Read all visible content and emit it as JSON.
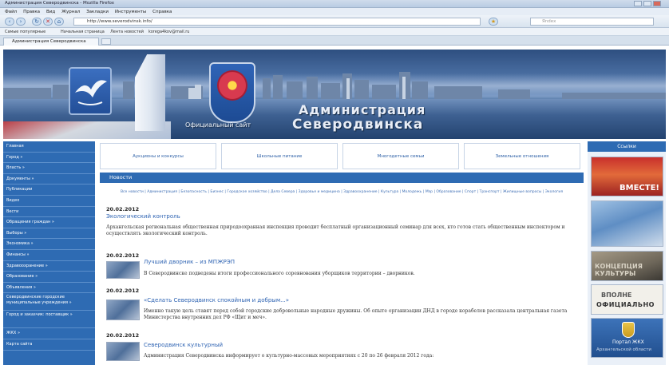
{
  "browser": {
    "window_title": "Администрация Северодвинска - Mozilla Firefox",
    "menu": [
      "Файл",
      "Правка",
      "Вид",
      "Журнал",
      "Закладки",
      "Инструменты",
      "Справка"
    ],
    "url": "http://www.severodvinsk.info/",
    "search_placeholder": "Яndex",
    "bookmarks": [
      "Самые популярные",
      "Начальная страница",
      "Лента новостей",
      "korega4kov@mail.ru"
    ],
    "tab_title": "Администрация Северодвинска"
  },
  "banner": {
    "title_line1": "Администрация",
    "title_line2": "Северодвинска",
    "subtitle": "Официальный сайт"
  },
  "sidebar": {
    "items": [
      "Главная",
      "Город »",
      "Власть »",
      "Документы »",
      "Публикации",
      "Видео",
      "Вести",
      "Обращения граждан »",
      "Выборы »",
      "Экономика »",
      "Финансы »",
      "Здравоохранение »",
      "Образование »",
      "Объявления »",
      "Северодвинские городские муниципальные учреждения »",
      "Город и заказчик: поставщик »",
      "ЖКХ »",
      "Карта сайта"
    ]
  },
  "topnav": [
    "Аукционы и конкурсы",
    "Школьные питание",
    "Многодетные семьи",
    "Земельные отношения"
  ],
  "news": {
    "header": "Новости",
    "breadcrumbs": "Все новости | Администрация | Безопасность | Бизнес | Городское хозяйство | Дела Севера | Здоровье и медицина | Здравоохранение | Культура | Молодежь | Мэр | Образование | Спорт | Транспорт | Жилищные вопросы | Экология",
    "articles": [
      {
        "date": "20.02.2012",
        "title": "Экологический контроль",
        "text": "Архангельская региональная общественная природоохранная инспекция проводит бесплатный организационный семинар для всех, кто готов стать общественным инспектором и осуществлять экологический контроль."
      },
      {
        "date": "20.02.2012",
        "title": "Лучший дворник – из МПЖРЭП",
        "text": "В Северодвинске подведены итоги профессионального соревнования уборщиков территории – дворников."
      },
      {
        "date": "20.02.2012",
        "title": "«Сделать Северодвинск спокойным и добрым...»",
        "text": "Именно такую цель ставят перед собой городские добровольные народные дружины. Об опыте организации ДНД в городе корабелов рассказала центральная газета Министерства внутренних дел РФ «Щит и меч»."
      },
      {
        "date": "20.02.2012",
        "title": "Северодвинск культурный",
        "text": "Администрация Северодвинска информирует о культурно-массовых мероприятиях с 20 по 26 февраля 2012 года:"
      }
    ]
  },
  "right": {
    "header": "Ссылки",
    "banner1_big": "ВМЕСТЕ!",
    "banner3_text": "КОНЦЕПЦИЯ КУЛЬТУРЫ",
    "banner4_line1": "ВПОЛНЕ",
    "banner4_line2": "ОФИЦИАЛЬНО",
    "banner5_line1": "Портал ЖКХ",
    "banner5_line2": "Архангельской области"
  }
}
